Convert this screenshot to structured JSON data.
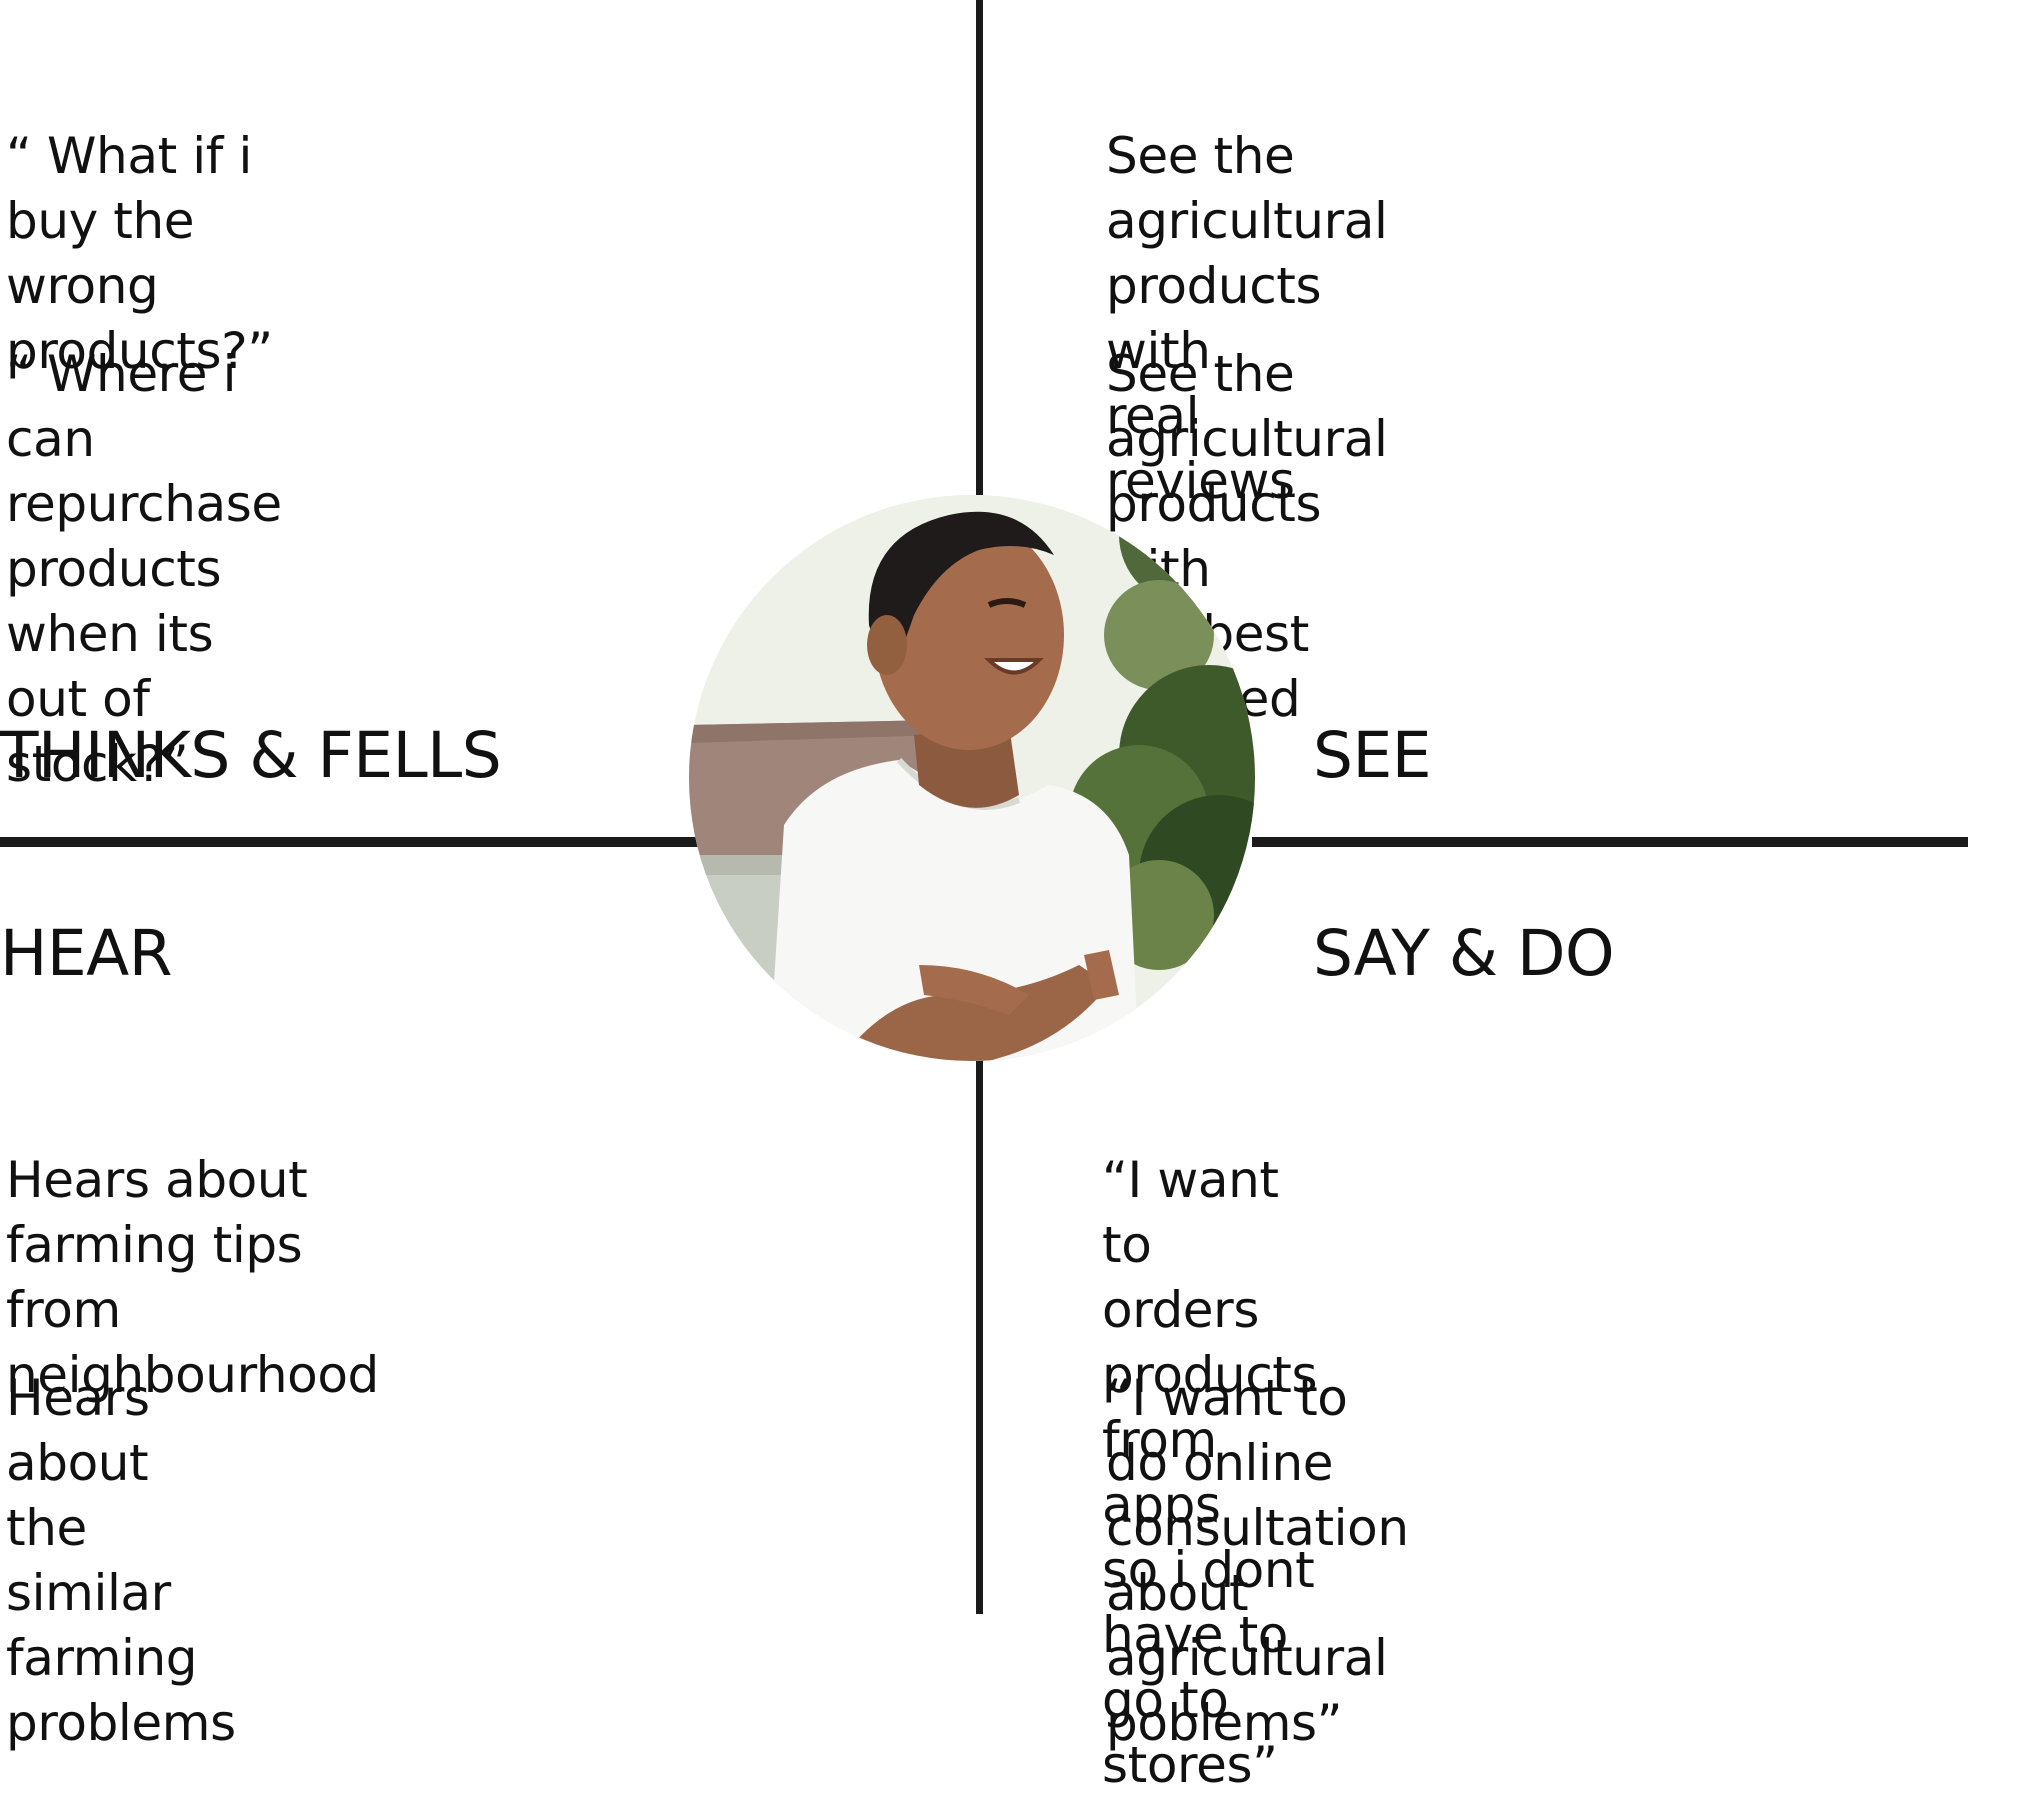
{
  "quadrants": {
    "thinks_feels": {
      "heading": "THINKS & FELLS",
      "items": [
        "“ What if i buy the wrong products?”",
        "“ Where i can repurchase products\n   when its out of stock?”"
      ]
    },
    "see": {
      "heading": "SEE",
      "items": [
        "See the agricultural products with\nreal reviews",
        "See the agricultural products with\nthe best claimed"
      ]
    },
    "hear": {
      "heading": "HEAR",
      "items": [
        "Hears about farming tips from\nneighbourhood",
        "Hears about the similar farming\nproblems"
      ]
    },
    "say_do": {
      "heading": "SAY & DO",
      "items": [
        "“I want to orders products from apps\nso i dont have to go to stores”",
        "“I want to do online consultation\nabout agricultural poblems”"
      ]
    }
  },
  "persona": {
    "photo_icon": "persona-photo"
  },
  "colors": {
    "lines": "#1b1b1b",
    "text": "#111111",
    "background": "#ffffff"
  }
}
